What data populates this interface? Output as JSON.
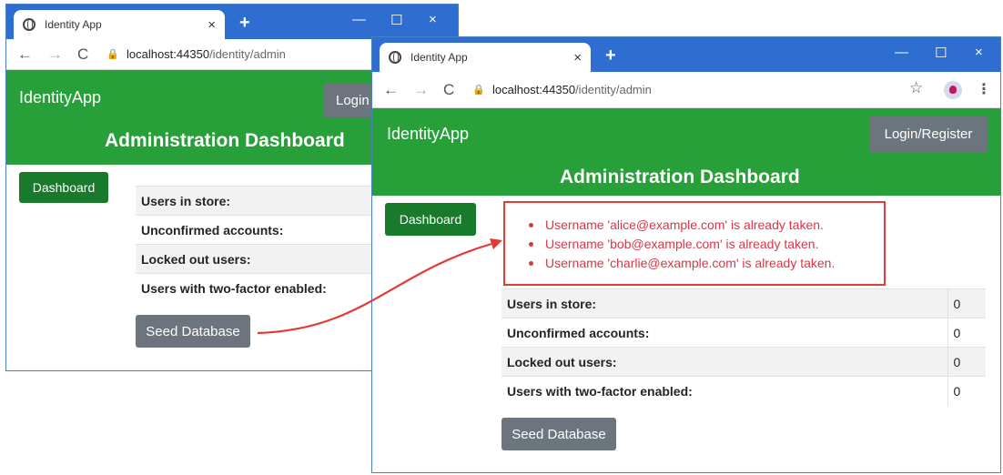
{
  "back_window": {
    "tab_title": "Identity App",
    "url_host": "localhost:44350",
    "url_path": "/identity/admin",
    "brand": "IdentityApp",
    "login_label": "Login",
    "title": "Administration Dashboard",
    "dashboard_label": "Dashboard",
    "stats": [
      {
        "label": "Users in store:"
      },
      {
        "label": "Unconfirmed accounts:"
      },
      {
        "label": "Locked out users:"
      },
      {
        "label": "Users with two-factor enabled:"
      }
    ],
    "seed_label": "Seed Database"
  },
  "front_window": {
    "tab_title": "Identity App",
    "url_host": "localhost:44350",
    "url_path": "/identity/admin",
    "brand": "IdentityApp",
    "login_label": "Login/Register",
    "title": "Administration Dashboard",
    "dashboard_label": "Dashboard",
    "errors": [
      "Username 'alice@example.com' is already taken.",
      "Username 'bob@example.com' is already taken.",
      "Username 'charlie@example.com' is already taken."
    ],
    "stats": [
      {
        "label": "Users in store:",
        "value": "0"
      },
      {
        "label": "Unconfirmed accounts:",
        "value": "0"
      },
      {
        "label": "Locked out users:",
        "value": "0"
      },
      {
        "label": "Users with two-factor enabled:",
        "value": "0"
      }
    ],
    "seed_label": "Seed Database"
  },
  "icons": {
    "close": "×",
    "new_tab": "+",
    "minimize": "—",
    "maximize": "☐",
    "back": "←",
    "forward": "→",
    "reload": "C",
    "lock": "🔒",
    "star": "☆",
    "kebab": "⋮"
  },
  "colors": {
    "titlebar": "#2f6ed1",
    "navbar": "#28a03a",
    "dashboard_button": "#187a2a",
    "secondary_button": "#6c757d",
    "error_text": "#dc3545",
    "callout": "#e53935"
  }
}
